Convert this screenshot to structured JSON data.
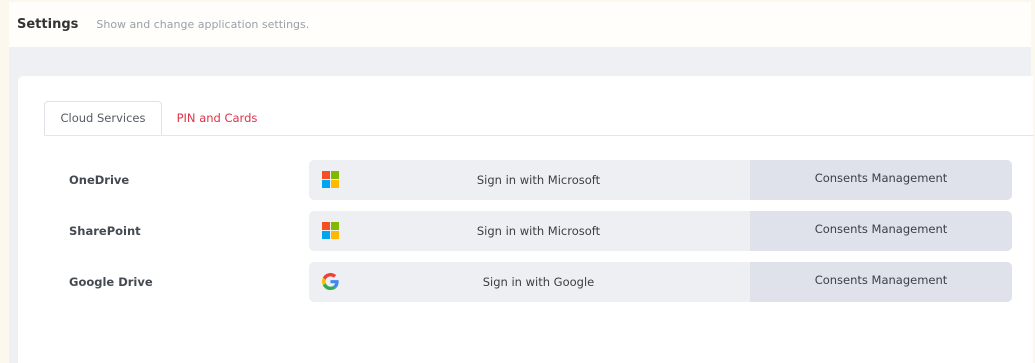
{
  "header": {
    "title": "Settings",
    "subtitle": "Show and change application settings."
  },
  "tabs": [
    {
      "label": "Cloud Services",
      "active": true
    },
    {
      "label": "PIN and Cards",
      "active": false
    }
  ],
  "services": [
    {
      "name": "OneDrive",
      "signin_label": "Sign in with Microsoft",
      "provider_icon": "microsoft-icon",
      "consent_label": "Consents Management"
    },
    {
      "name": "SharePoint",
      "signin_label": "Sign in with Microsoft",
      "provider_icon": "microsoft-icon",
      "consent_label": "Consents Management"
    },
    {
      "name": "Google Drive",
      "signin_label": "Sign in with Google",
      "provider_icon": "google-icon",
      "consent_label": "Consents Management"
    }
  ],
  "colors": {
    "accent_inactive_tab": "#e0324a",
    "signin_bg": "#edeff2",
    "consent_bg": "#dfe2ea"
  }
}
